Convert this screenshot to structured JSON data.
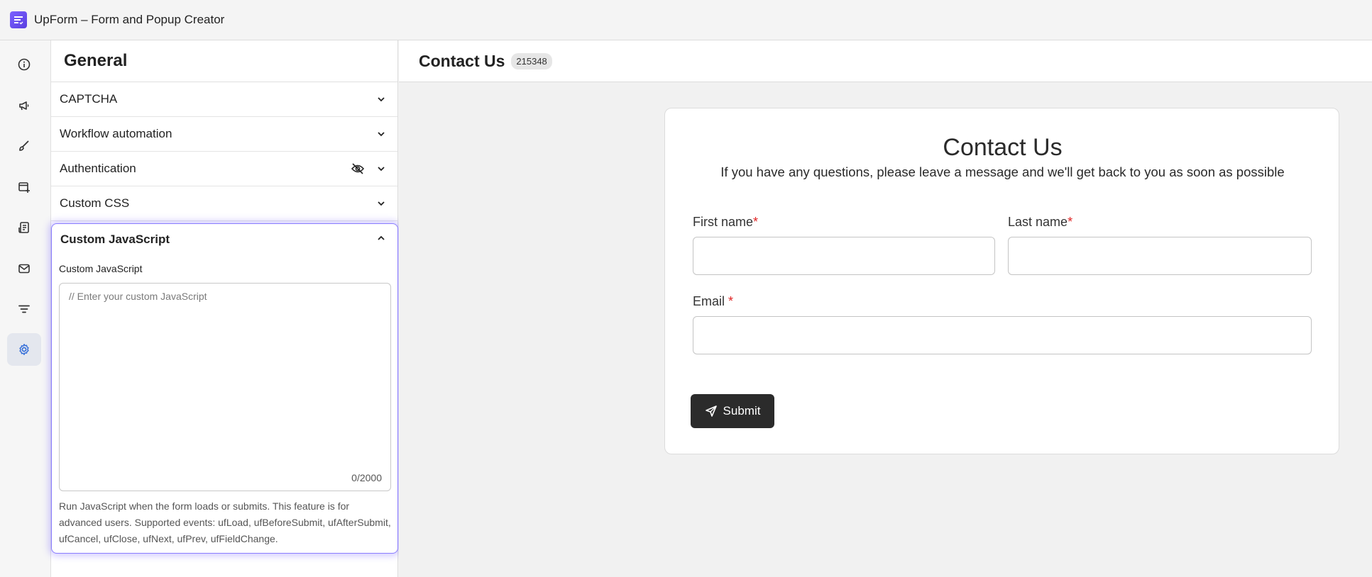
{
  "app": {
    "title": "UpForm – Form and Popup Creator"
  },
  "iconbar": {
    "items": [
      {
        "icon": "info-icon"
      },
      {
        "icon": "megaphone-icon"
      },
      {
        "icon": "brush-icon"
      },
      {
        "icon": "add-window-icon"
      },
      {
        "icon": "receipt-icon"
      },
      {
        "icon": "mail-icon"
      },
      {
        "icon": "filter-icon"
      },
      {
        "icon": "gear-icon",
        "active": true
      }
    ]
  },
  "settings": {
    "title": "General",
    "sections": [
      {
        "label": "CAPTCHA"
      },
      {
        "label": "Workflow automation"
      },
      {
        "label": "Authentication",
        "icon": "eye-off-icon"
      },
      {
        "label": "Custom CSS"
      }
    ],
    "custom_js": {
      "header": "Custom JavaScript",
      "field_label": "Custom JavaScript",
      "placeholder": "// Enter your custom JavaScript",
      "counter": "0/2000",
      "help": "Run JavaScript when the form loads or submits. This feature is for advanced users. Supported events: ufLoad, ufBeforeSubmit, ufAfterSubmit, ufCancel, ufClose, ufNext, ufPrev, ufFieldChange."
    }
  },
  "canvas": {
    "title": "Contact Us",
    "badge": "215348"
  },
  "form": {
    "title": "Contact Us",
    "subtitle": "If you have any questions, please leave a message and we'll get back to you as soon as possible",
    "fields": {
      "first_name": "First name",
      "last_name": "Last name",
      "email": "Email"
    },
    "required_mark": "*",
    "submit_label": "Submit"
  },
  "colors": {
    "accent": "#8a7dff",
    "active_icon": "#2f6bd8",
    "required": "#e02424",
    "submit_bg": "#2b2b2b"
  }
}
